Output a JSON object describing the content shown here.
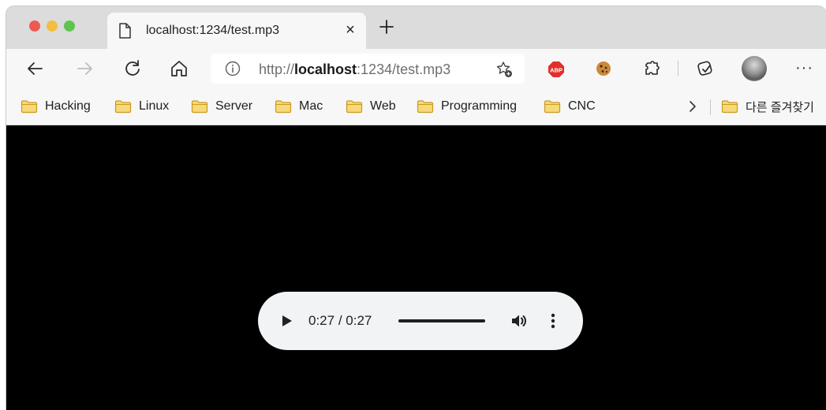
{
  "tab": {
    "title": "localhost:1234/test.mp3",
    "close_label": "×",
    "new_tab_icon": "plus-icon",
    "file_icon": "document-icon"
  },
  "toolbar": {
    "icons": [
      "back-arrow-icon",
      "forward-arrow-icon",
      "refresh-icon",
      "home-icon",
      "abp-icon",
      "cookie-icon",
      "extensions-icon",
      "collections-icon",
      "profile-avatar",
      "more-icon"
    ],
    "abp_label": "ABP",
    "more_label": "···"
  },
  "address_bar": {
    "prefix": "http://",
    "host": "localhost",
    "suffix": ":1234/test.mp3",
    "info_icon": "info-icon",
    "favorite_icon": "favorite-star-add-icon"
  },
  "bookmarks": {
    "items": [
      {
        "label": "Hacking"
      },
      {
        "label": "Linux"
      },
      {
        "label": "Server"
      },
      {
        "label": "Mac"
      },
      {
        "label": "Web"
      },
      {
        "label": "Programming"
      },
      {
        "label": "CNC"
      }
    ],
    "other_favorites": "다른 즐겨찾기",
    "folder_color": "#f3c64a"
  },
  "player": {
    "current_time": "0:27",
    "separator": " / ",
    "duration": "0:27",
    "progress": 1.0,
    "background": "#f1f3f4"
  },
  "colors": {
    "content_background": "#000000",
    "close_red": "#ee5a52",
    "minimize_yellow": "#f5bd3f",
    "zoom_green": "#5fc350",
    "abp_red": "#e0302b"
  }
}
